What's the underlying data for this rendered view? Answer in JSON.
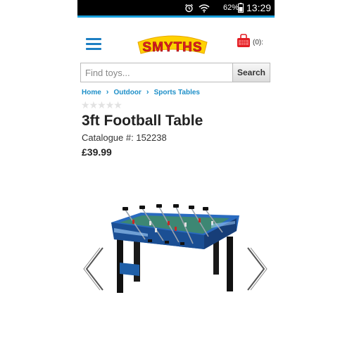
{
  "status_bar": {
    "battery_percent": "62%",
    "time": "13:29",
    "icons": [
      "alarm-icon",
      "wifi-icon",
      "battery-icon"
    ]
  },
  "header": {
    "menu_icon": "hamburger-icon",
    "logo_text": "SMYTHS",
    "basket_count": "(0):"
  },
  "search": {
    "placeholder": "Find toys...",
    "button_label": "Search"
  },
  "breadcrumb": [
    "Home",
    "Outdoor",
    "Sports Tables"
  ],
  "product": {
    "rating_stars": 0,
    "rating_max": 5,
    "title": "3ft Football Table",
    "catalogue": "Catalogue #: 152238",
    "price": "£39.99"
  },
  "colors": {
    "accent": "#19a0dc",
    "link": "#1d8fc8",
    "logo_red": "#e31e24",
    "logo_yellow": "#ffd200"
  }
}
